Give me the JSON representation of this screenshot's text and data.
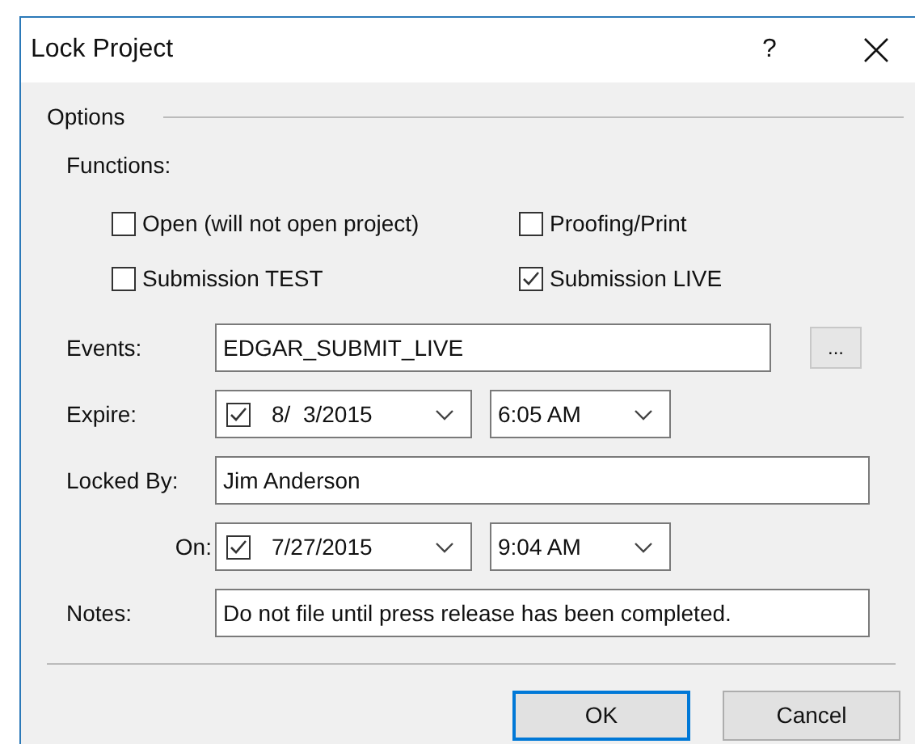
{
  "window": {
    "title": "Lock Project",
    "help": "?"
  },
  "options": {
    "title": "Options",
    "functions_label": "Functions:",
    "functions": [
      {
        "label": "Open (will not open project)",
        "checked": false
      },
      {
        "label": "Proofing/Print",
        "checked": false
      },
      {
        "label": "Submission TEST",
        "checked": false
      },
      {
        "label": "Submission LIVE",
        "checked": true
      }
    ]
  },
  "events": {
    "label": "Events:",
    "value": "EDGAR_SUBMIT_LIVE",
    "browse": "..."
  },
  "expire": {
    "label": "Expire:",
    "checked": true,
    "date": "8/  3/2015",
    "time": "6:05 AM"
  },
  "locked_by": {
    "label": "Locked By:",
    "value": "Jim Anderson"
  },
  "on": {
    "label": "On:",
    "checked": true,
    "date": "7/27/2015",
    "time": "9:04 AM"
  },
  "notes": {
    "label": "Notes:",
    "value": "Do not file until press release has been completed."
  },
  "buttons": [
    {
      "label": "OK",
      "default": true
    },
    {
      "label": "Cancel",
      "default": false
    }
  ]
}
